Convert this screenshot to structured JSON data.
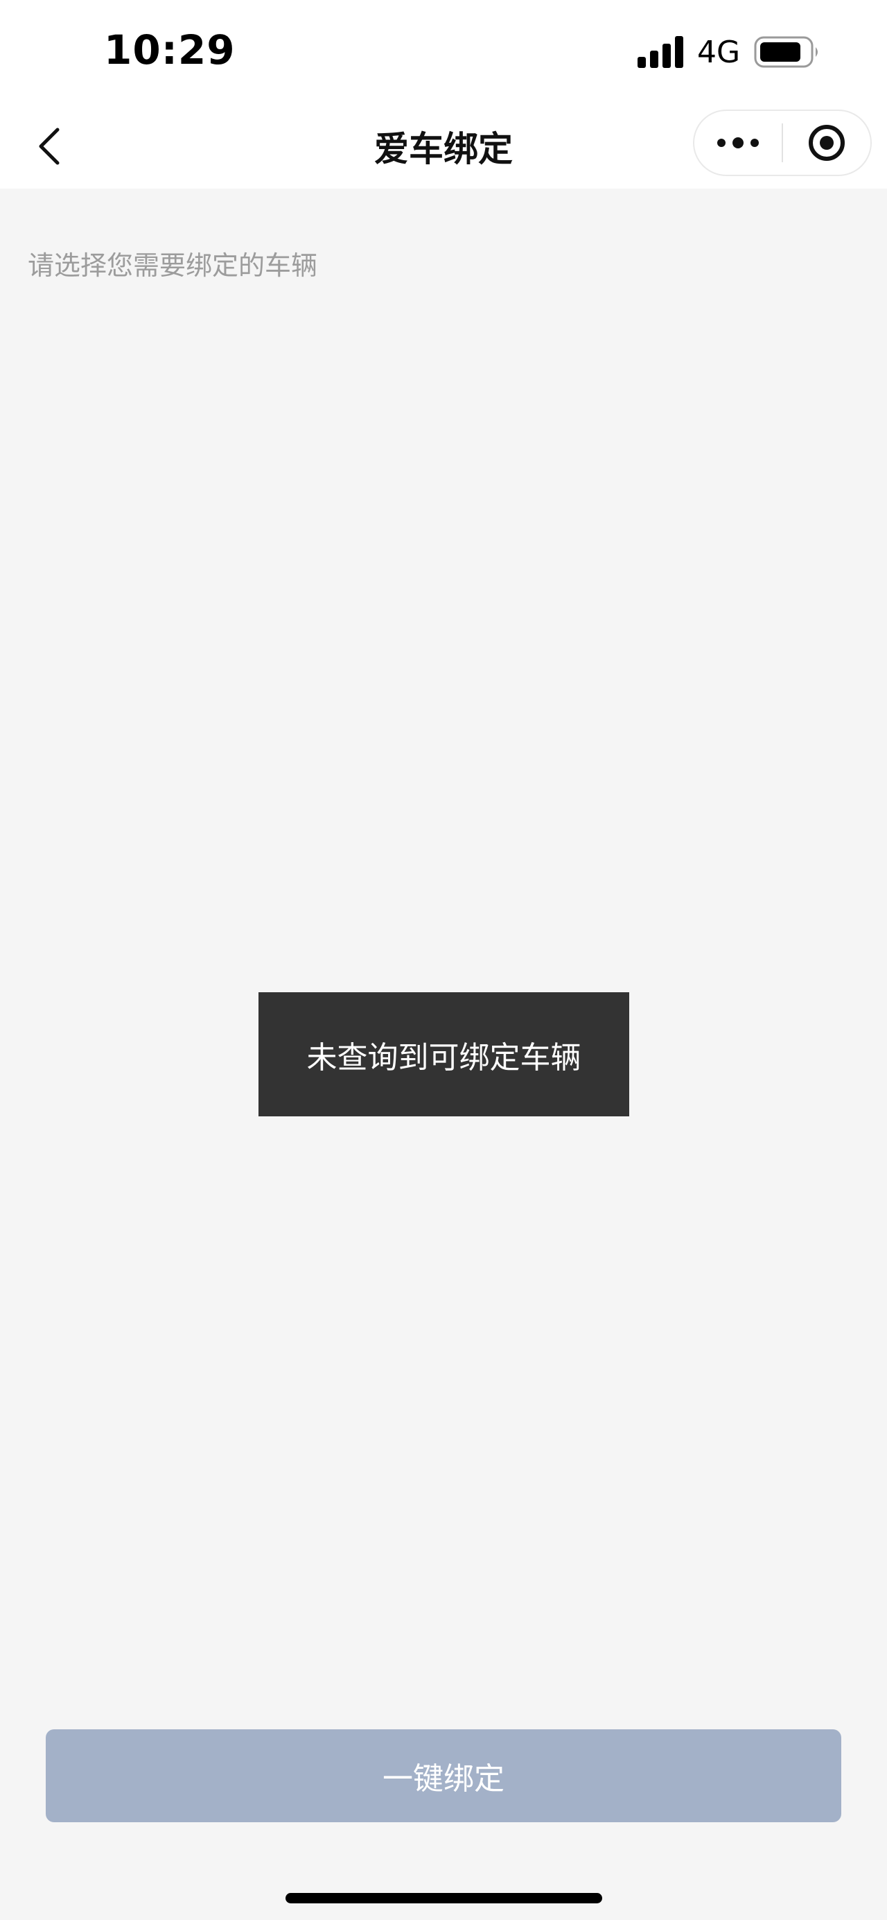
{
  "status_bar": {
    "time": "10:29",
    "network": "4G",
    "signal_icon": "cellular-signal-icon",
    "battery_icon": "battery-icon"
  },
  "nav": {
    "title": "爱车绑定",
    "back_icon": "chevron-left-icon",
    "more_icon": "more-dots-icon",
    "close_icon": "target-circle-icon"
  },
  "content": {
    "hint": "请选择您需要绑定的车辆"
  },
  "toast": {
    "message": "未查询到可绑定车辆"
  },
  "actions": {
    "bind_label": "一键绑定"
  },
  "colors": {
    "background": "#f5f5f5",
    "toast_bg": "#333333",
    "button_bg": "#a3b1c8",
    "hint_text": "#9c9c9c"
  }
}
